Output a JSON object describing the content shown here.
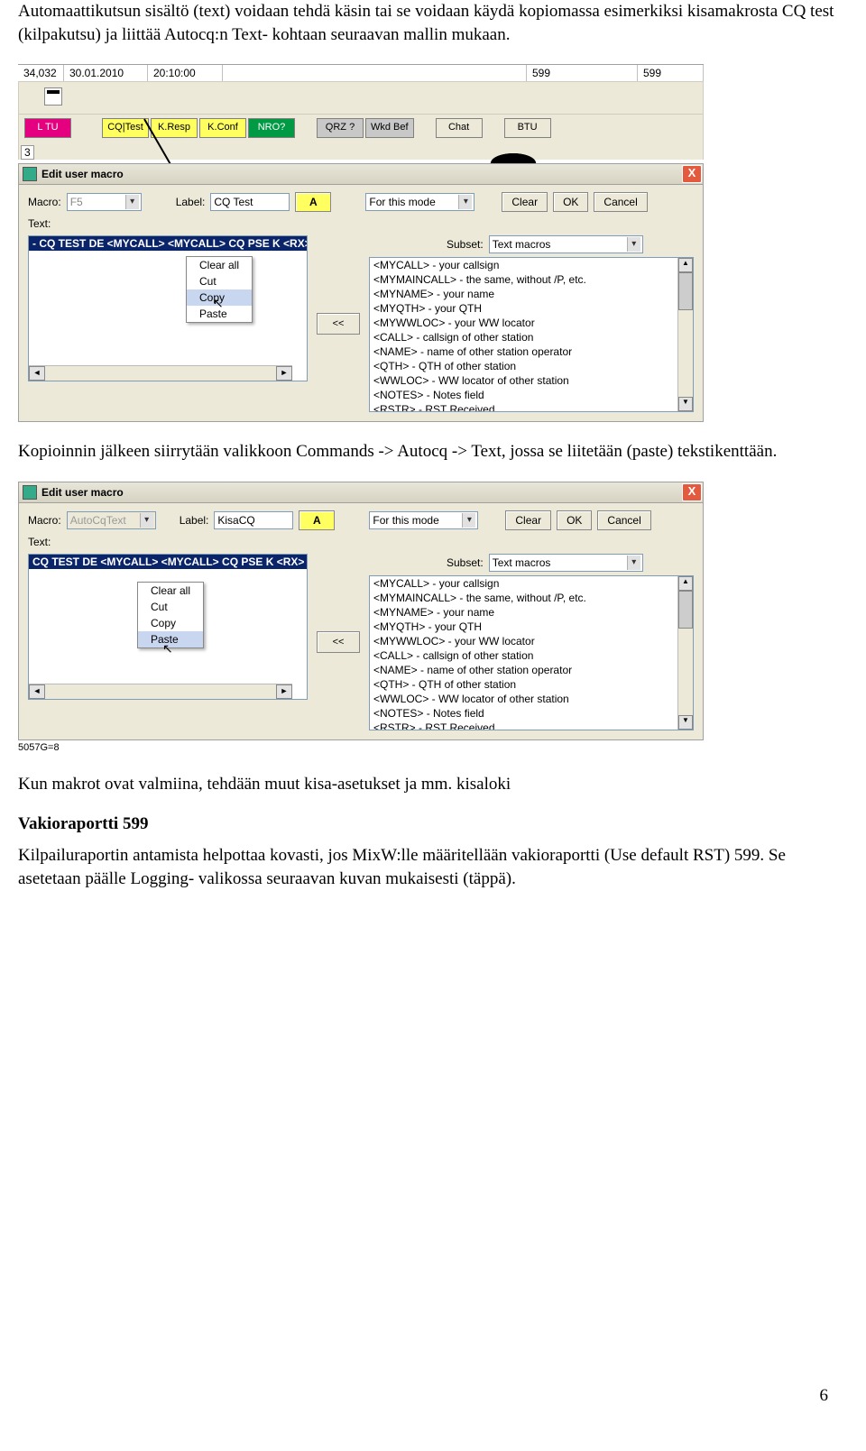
{
  "para1": "Automaattikutsun sisältö (text) voidaan tehdä käsin tai se voidaan käydä kopiomassa esimerkiksi kisamakrosta CQ test (kilpakutsu) ja liittää Autocq:n Text- kohtaan seuraavan mallin mukaan.",
  "para2": "Kopioinnin jälkeen siirrytään valikkoon Commands -> Autocq -> Text,  jossa se liitetään (paste) tekstikenttään.",
  "para3": "Kun makrot ovat valmiina, tehdään muut kisa-asetukset ja mm. kisaloki",
  "heading1": "Vakioraportti 599",
  "para4": "Kilpailuraportin antamista helpottaa kovasti, jos MixW:lle määritellään vakioraportti (Use default RST) 599. Se asetetaan päälle Logging- valikossa seuraavan kuvan mukaisesti (täppä).",
  "pagenum": "6",
  "top": {
    "c0": "34,032",
    "c1": "30.01.2010",
    "c2": "20:10:00",
    "c3": "599",
    "c4": "599"
  },
  "macrobar": {
    "b0": "L TU",
    "b1": "CQ|Test",
    "b2": "K.Resp",
    "b3": "K.Conf",
    "b4": "NRO?",
    "b5": "QRZ ?",
    "b6": "Wkd Bef",
    "b7": "Chat",
    "b8": "BTU",
    "leftnum": "3"
  },
  "win": {
    "title": "Edit user macro",
    "lblMacro": "Macro:",
    "lblLabel": "Label:",
    "lblText": "Text:",
    "lblMode": "For this mode",
    "lblSubset": "Subset:",
    "btnClear": "Clear",
    "btnOK": "OK",
    "btnCancel": "Cancel",
    "btnA": "A",
    "btnIns": "<<",
    "subsetVal": "Text macros"
  },
  "s1": {
    "macroVal": "F5",
    "labelVal": "CQ Test",
    "textline": "- CQ TEST DE <MYCALL> <MYCALL> CQ PSE K <RX>",
    "ctx": [
      "Clear all",
      "Cut",
      "Copy",
      "Paste"
    ],
    "ctxHi": 2
  },
  "s2": {
    "macroVal": "AutoCqText",
    "labelVal": "KisaCQ",
    "textline": "CQ TEST DE <MYCALL> <MYCALL> CQ PSE K <RX>",
    "ctx": [
      "Clear all",
      "Cut",
      "Copy",
      "Paste"
    ],
    "ctxHi": 3,
    "footer": "5057G=8"
  },
  "maclist": [
    "<MYCALL> - your callsign",
    "<MYMAINCALL> - the same, without /P, etc.",
    "<MYNAME> - your name",
    "<MYQTH> - your QTH",
    "<MYWWLOC> - your WW locator",
    "<CALL> - callsign of other station",
    "<NAME> - name of other station operator",
    "<QTH> - QTH of other station",
    "<WWLOC> - WW locator of other station",
    "<NOTES> - Notes field",
    "<RSTR> - RST Received"
  ]
}
